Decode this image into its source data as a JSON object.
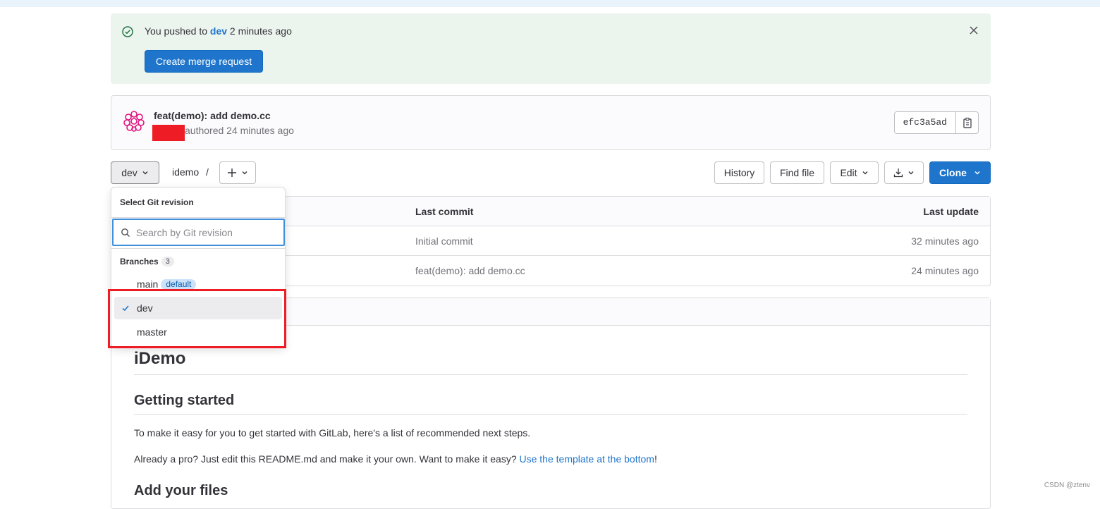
{
  "alert": {
    "prefix": "You pushed to",
    "branch": "dev",
    "suffix": "2 minutes ago",
    "button": "Create merge request"
  },
  "commit": {
    "title": "feat(demo): add demo.cc",
    "authored": "authored 24 minutes ago",
    "sha": "efc3a5ad"
  },
  "toolbar": {
    "ref": "dev",
    "path": "idemo",
    "path_sep": "/",
    "history": "History",
    "find_file": "Find file",
    "edit": "Edit",
    "clone": "Clone"
  },
  "table": {
    "headers": {
      "last_commit": "Last commit",
      "last_update": "Last update"
    },
    "rows": [
      {
        "commit": "Initial commit",
        "update": "32 minutes ago"
      },
      {
        "commit": "feat(demo): add demo.cc",
        "update": "24 minutes ago"
      }
    ]
  },
  "readme": {
    "h1": "iDemo",
    "h2": "Getting started",
    "p1": "To make it easy for you to get started with GitLab, here's a list of recommended next steps.",
    "p2_text": "Already a pro? Just edit this README.md and make it your own. Want to make it easy?",
    "p2_link": "Use the template at the bottom",
    "p2_end": "!",
    "h3": "Add your files"
  },
  "dropdown": {
    "title": "Select Git revision",
    "search_placeholder": "Search by Git revision",
    "group_label": "Branches",
    "group_count": "3",
    "items": [
      {
        "label": "main",
        "badge": "default"
      },
      {
        "label": "dev",
        "selected": true
      },
      {
        "label": "master"
      }
    ]
  },
  "watermark": "CSDN @ztenv",
  "colors": {
    "primary": "#1f75cb",
    "alert_bg": "#ecf4ee",
    "highlight": "#ee1c25"
  }
}
